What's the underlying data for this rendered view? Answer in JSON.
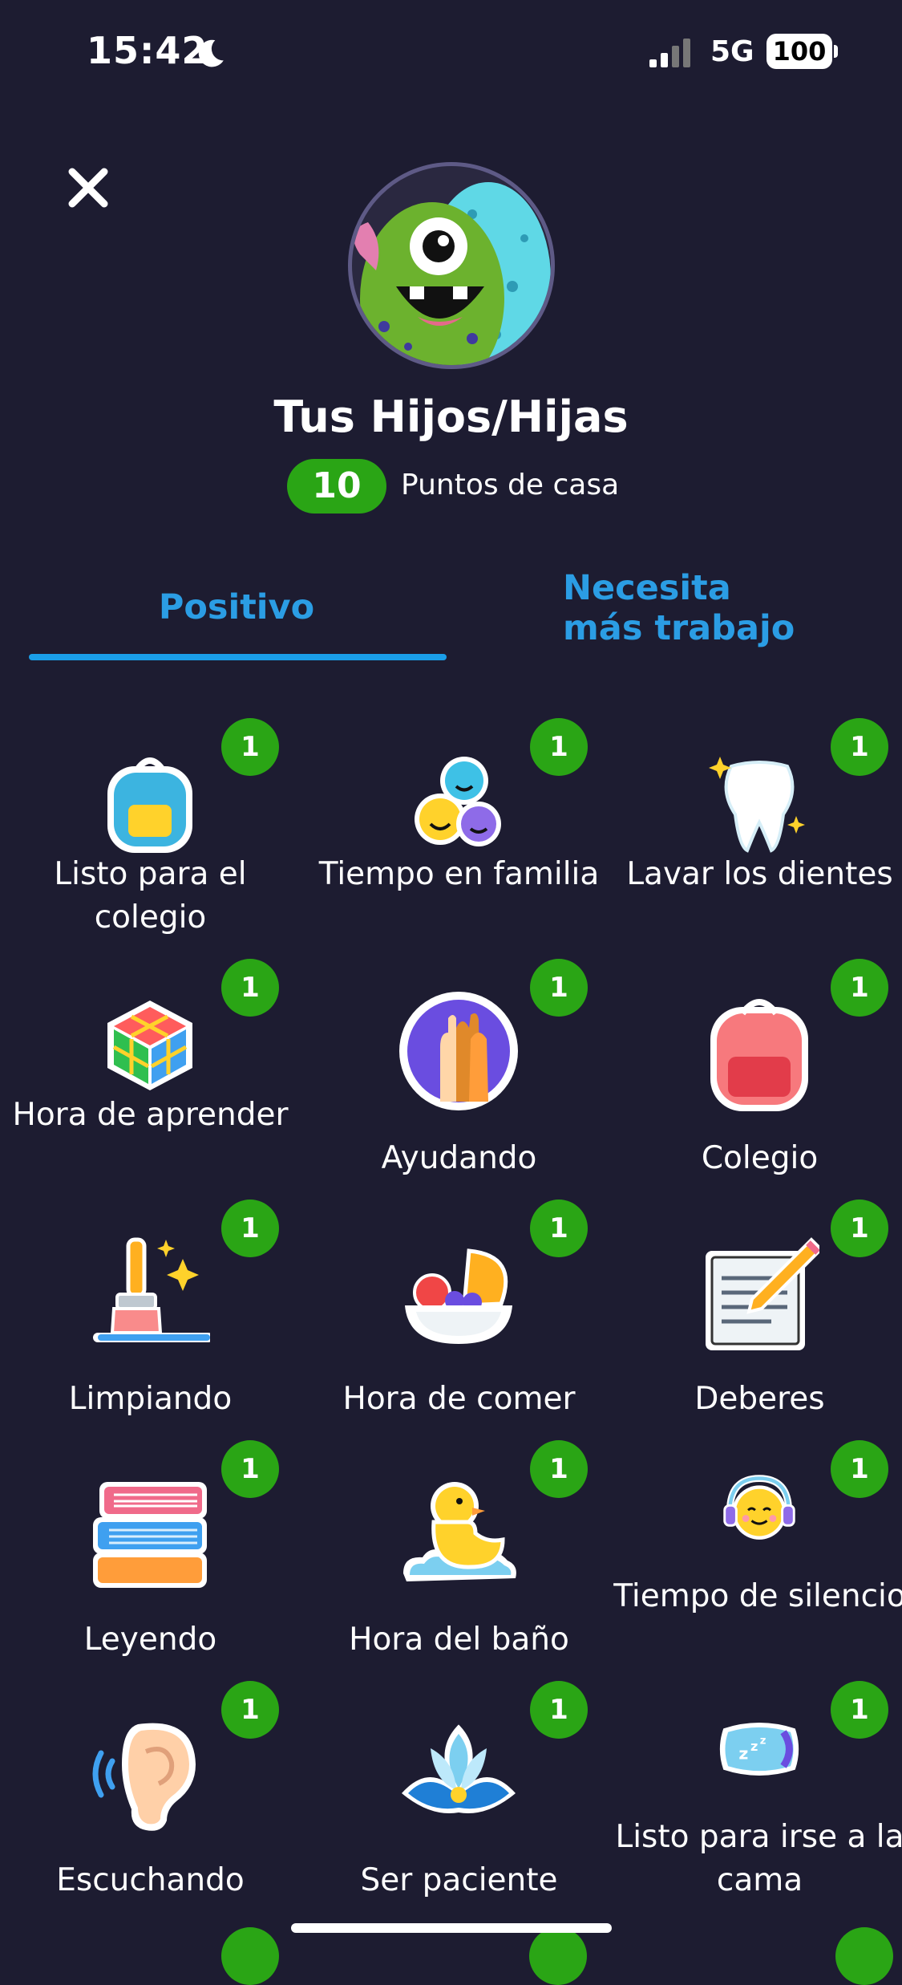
{
  "status_bar": {
    "time": "15:42",
    "network": "5G",
    "battery": "100"
  },
  "profile": {
    "name": "Tus Hijos/Hijas",
    "points": "10",
    "points_label": "Puntos de casa"
  },
  "tabs": [
    {
      "label": "Positivo",
      "selected": true
    },
    {
      "label": "Necesita\nmás trabajo",
      "selected": false
    }
  ],
  "skills": [
    {
      "label": "Listo para el colegio",
      "count": "1",
      "icon": "backpack-blue-icon"
    },
    {
      "label": "Tiempo en familia",
      "count": "1",
      "icon": "family-faces-icon"
    },
    {
      "label": "Lavar los dientes",
      "count": "1",
      "icon": "tooth-icon"
    },
    {
      "label": "Hora de aprender",
      "count": "1",
      "icon": "rubiks-cube-icon"
    },
    {
      "label": "Ayudando",
      "count": "1",
      "icon": "helping-hands-icon"
    },
    {
      "label": "Colegio",
      "count": "1",
      "icon": "backpack-red-icon"
    },
    {
      "label": "Limpiando",
      "count": "1",
      "icon": "paintbrush-sparkle-icon"
    },
    {
      "label": "Hora de comer",
      "count": "1",
      "icon": "fruit-bowl-icon"
    },
    {
      "label": "Deberes",
      "count": "1",
      "icon": "notebook-pencil-icon"
    },
    {
      "label": "Leyendo",
      "count": "1",
      "icon": "books-icon"
    },
    {
      "label": "Hora del baño",
      "count": "1",
      "icon": "rubber-duck-icon"
    },
    {
      "label": "Tiempo de silencio",
      "count": "1",
      "icon": "headphones-face-icon"
    },
    {
      "label": "Escuchando",
      "count": "1",
      "icon": "ear-icon"
    },
    {
      "label": "Ser paciente",
      "count": "1",
      "icon": "lotus-icon"
    },
    {
      "label": "Listo para irse a la cama",
      "count": "1",
      "icon": "pillow-icon"
    }
  ],
  "colors": {
    "background": "#1d1c31",
    "accent": "#2b9de4",
    "badge": "#2aa515"
  }
}
